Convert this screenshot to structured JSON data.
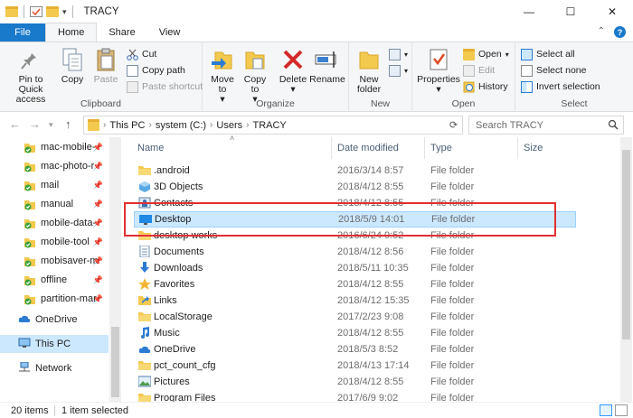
{
  "window": {
    "title": "TRACY",
    "min": "—",
    "max": "☐",
    "close": "✕"
  },
  "tabs": [
    "File",
    "Home",
    "Share",
    "View"
  ],
  "ribbon": {
    "clipboard": {
      "label": "Clipboard",
      "pin": "Pin to Quick access",
      "copy": "Copy",
      "paste": "Paste",
      "cut": "Cut",
      "copy_path": "Copy path",
      "paste_shortcut": "Paste shortcut"
    },
    "organize": {
      "label": "Organize",
      "move_to": "Move to",
      "copy_to": "Copy to",
      "delete": "Delete",
      "rename": "Rename"
    },
    "new": {
      "label": "New",
      "new_folder": "New folder"
    },
    "open": {
      "label": "Open",
      "properties": "Properties",
      "open": "Open",
      "edit": "Edit",
      "history": "History"
    },
    "select": {
      "label": "Select",
      "select_all": "Select all",
      "select_none": "Select none",
      "invert": "Invert selection"
    }
  },
  "address": {
    "crumbs": [
      "This PC",
      "system (C:)",
      "Users",
      "TRACY"
    ],
    "search_placeholder": "Search TRACY"
  },
  "nav": {
    "pinned": [
      "mac-mobile-",
      "mac-photo-r",
      "mail",
      "manual",
      "mobile-data-",
      "mobile-tool",
      "mobisaver-m",
      "offline",
      "partition-mar"
    ],
    "onedrive": "OneDrive",
    "this_pc": "This PC",
    "network": "Network"
  },
  "columns": {
    "name": "Name",
    "date": "Date modified",
    "type": "Type",
    "size": "Size"
  },
  "files": [
    {
      "name": ".android",
      "date": "2016/3/14 8:57",
      "type": "File folder",
      "icon": "folder"
    },
    {
      "name": "3D Objects",
      "date": "2018/4/12 8:55",
      "type": "File folder",
      "icon": "cube"
    },
    {
      "name": "Contacts",
      "date": "2018/4/12 8:55",
      "type": "File folder",
      "icon": "contacts"
    },
    {
      "name": "Desktop",
      "date": "2018/5/9 14:01",
      "type": "File folder",
      "icon": "desktop",
      "selected": true
    },
    {
      "name": "desktop works",
      "date": "2016/6/24 9:52",
      "type": "File folder",
      "icon": "folder"
    },
    {
      "name": "Documents",
      "date": "2018/4/12 8:56",
      "type": "File folder",
      "icon": "documents"
    },
    {
      "name": "Downloads",
      "date": "2018/5/11 10:35",
      "type": "File folder",
      "icon": "downloads"
    },
    {
      "name": "Favorites",
      "date": "2018/4/12 8:55",
      "type": "File folder",
      "icon": "star"
    },
    {
      "name": "Links",
      "date": "2018/4/12 15:35",
      "type": "File folder",
      "icon": "links"
    },
    {
      "name": "LocalStorage",
      "date": "2017/2/23 9:08",
      "type": "File folder",
      "icon": "folder"
    },
    {
      "name": "Music",
      "date": "2018/4/12 8:55",
      "type": "File folder",
      "icon": "music"
    },
    {
      "name": "OneDrive",
      "date": "2018/5/3 8:52",
      "type": "File folder",
      "icon": "cloud"
    },
    {
      "name": "pct_count_cfg",
      "date": "2018/4/13 17:14",
      "type": "File folder",
      "icon": "folder"
    },
    {
      "name": "Pictures",
      "date": "2018/4/12 8:55",
      "type": "File folder",
      "icon": "pictures"
    },
    {
      "name": "Program Files",
      "date": "2017/6/9 9:02",
      "type": "File folder",
      "icon": "folder"
    }
  ],
  "status": {
    "count": "20 items",
    "selected": "1 item selected"
  },
  "colors": {
    "accent": "#1979ca",
    "selection": "#cce8ff",
    "highlight": "#e03030",
    "folder": "#f3c94e"
  }
}
